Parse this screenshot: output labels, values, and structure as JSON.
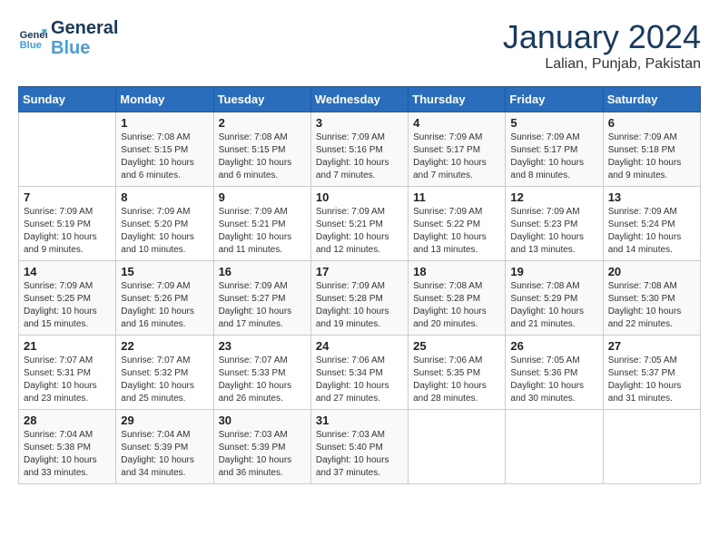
{
  "header": {
    "logo_line1": "General",
    "logo_line2": "Blue",
    "month": "January 2024",
    "location": "Lalian, Punjab, Pakistan"
  },
  "weekdays": [
    "Sunday",
    "Monday",
    "Tuesday",
    "Wednesday",
    "Thursday",
    "Friday",
    "Saturday"
  ],
  "weeks": [
    [
      {
        "day": "",
        "info": ""
      },
      {
        "day": "1",
        "info": "Sunrise: 7:08 AM\nSunset: 5:15 PM\nDaylight: 10 hours\nand 6 minutes."
      },
      {
        "day": "2",
        "info": "Sunrise: 7:08 AM\nSunset: 5:15 PM\nDaylight: 10 hours\nand 6 minutes."
      },
      {
        "day": "3",
        "info": "Sunrise: 7:09 AM\nSunset: 5:16 PM\nDaylight: 10 hours\nand 7 minutes."
      },
      {
        "day": "4",
        "info": "Sunrise: 7:09 AM\nSunset: 5:17 PM\nDaylight: 10 hours\nand 7 minutes."
      },
      {
        "day": "5",
        "info": "Sunrise: 7:09 AM\nSunset: 5:17 PM\nDaylight: 10 hours\nand 8 minutes."
      },
      {
        "day": "6",
        "info": "Sunrise: 7:09 AM\nSunset: 5:18 PM\nDaylight: 10 hours\nand 9 minutes."
      }
    ],
    [
      {
        "day": "7",
        "info": "Sunrise: 7:09 AM\nSunset: 5:19 PM\nDaylight: 10 hours\nand 9 minutes."
      },
      {
        "day": "8",
        "info": "Sunrise: 7:09 AM\nSunset: 5:20 PM\nDaylight: 10 hours\nand 10 minutes."
      },
      {
        "day": "9",
        "info": "Sunrise: 7:09 AM\nSunset: 5:21 PM\nDaylight: 10 hours\nand 11 minutes."
      },
      {
        "day": "10",
        "info": "Sunrise: 7:09 AM\nSunset: 5:21 PM\nDaylight: 10 hours\nand 12 minutes."
      },
      {
        "day": "11",
        "info": "Sunrise: 7:09 AM\nSunset: 5:22 PM\nDaylight: 10 hours\nand 13 minutes."
      },
      {
        "day": "12",
        "info": "Sunrise: 7:09 AM\nSunset: 5:23 PM\nDaylight: 10 hours\nand 13 minutes."
      },
      {
        "day": "13",
        "info": "Sunrise: 7:09 AM\nSunset: 5:24 PM\nDaylight: 10 hours\nand 14 minutes."
      }
    ],
    [
      {
        "day": "14",
        "info": "Sunrise: 7:09 AM\nSunset: 5:25 PM\nDaylight: 10 hours\nand 15 minutes."
      },
      {
        "day": "15",
        "info": "Sunrise: 7:09 AM\nSunset: 5:26 PM\nDaylight: 10 hours\nand 16 minutes."
      },
      {
        "day": "16",
        "info": "Sunrise: 7:09 AM\nSunset: 5:27 PM\nDaylight: 10 hours\nand 17 minutes."
      },
      {
        "day": "17",
        "info": "Sunrise: 7:09 AM\nSunset: 5:28 PM\nDaylight: 10 hours\nand 19 minutes."
      },
      {
        "day": "18",
        "info": "Sunrise: 7:08 AM\nSunset: 5:28 PM\nDaylight: 10 hours\nand 20 minutes."
      },
      {
        "day": "19",
        "info": "Sunrise: 7:08 AM\nSunset: 5:29 PM\nDaylight: 10 hours\nand 21 minutes."
      },
      {
        "day": "20",
        "info": "Sunrise: 7:08 AM\nSunset: 5:30 PM\nDaylight: 10 hours\nand 22 minutes."
      }
    ],
    [
      {
        "day": "21",
        "info": "Sunrise: 7:07 AM\nSunset: 5:31 PM\nDaylight: 10 hours\nand 23 minutes."
      },
      {
        "day": "22",
        "info": "Sunrise: 7:07 AM\nSunset: 5:32 PM\nDaylight: 10 hours\nand 25 minutes."
      },
      {
        "day": "23",
        "info": "Sunrise: 7:07 AM\nSunset: 5:33 PM\nDaylight: 10 hours\nand 26 minutes."
      },
      {
        "day": "24",
        "info": "Sunrise: 7:06 AM\nSunset: 5:34 PM\nDaylight: 10 hours\nand 27 minutes."
      },
      {
        "day": "25",
        "info": "Sunrise: 7:06 AM\nSunset: 5:35 PM\nDaylight: 10 hours\nand 28 minutes."
      },
      {
        "day": "26",
        "info": "Sunrise: 7:05 AM\nSunset: 5:36 PM\nDaylight: 10 hours\nand 30 minutes."
      },
      {
        "day": "27",
        "info": "Sunrise: 7:05 AM\nSunset: 5:37 PM\nDaylight: 10 hours\nand 31 minutes."
      }
    ],
    [
      {
        "day": "28",
        "info": "Sunrise: 7:04 AM\nSunset: 5:38 PM\nDaylight: 10 hours\nand 33 minutes."
      },
      {
        "day": "29",
        "info": "Sunrise: 7:04 AM\nSunset: 5:39 PM\nDaylight: 10 hours\nand 34 minutes."
      },
      {
        "day": "30",
        "info": "Sunrise: 7:03 AM\nSunset: 5:39 PM\nDaylight: 10 hours\nand 36 minutes."
      },
      {
        "day": "31",
        "info": "Sunrise: 7:03 AM\nSunset: 5:40 PM\nDaylight: 10 hours\nand 37 minutes."
      },
      {
        "day": "",
        "info": ""
      },
      {
        "day": "",
        "info": ""
      },
      {
        "day": "",
        "info": ""
      }
    ]
  ]
}
